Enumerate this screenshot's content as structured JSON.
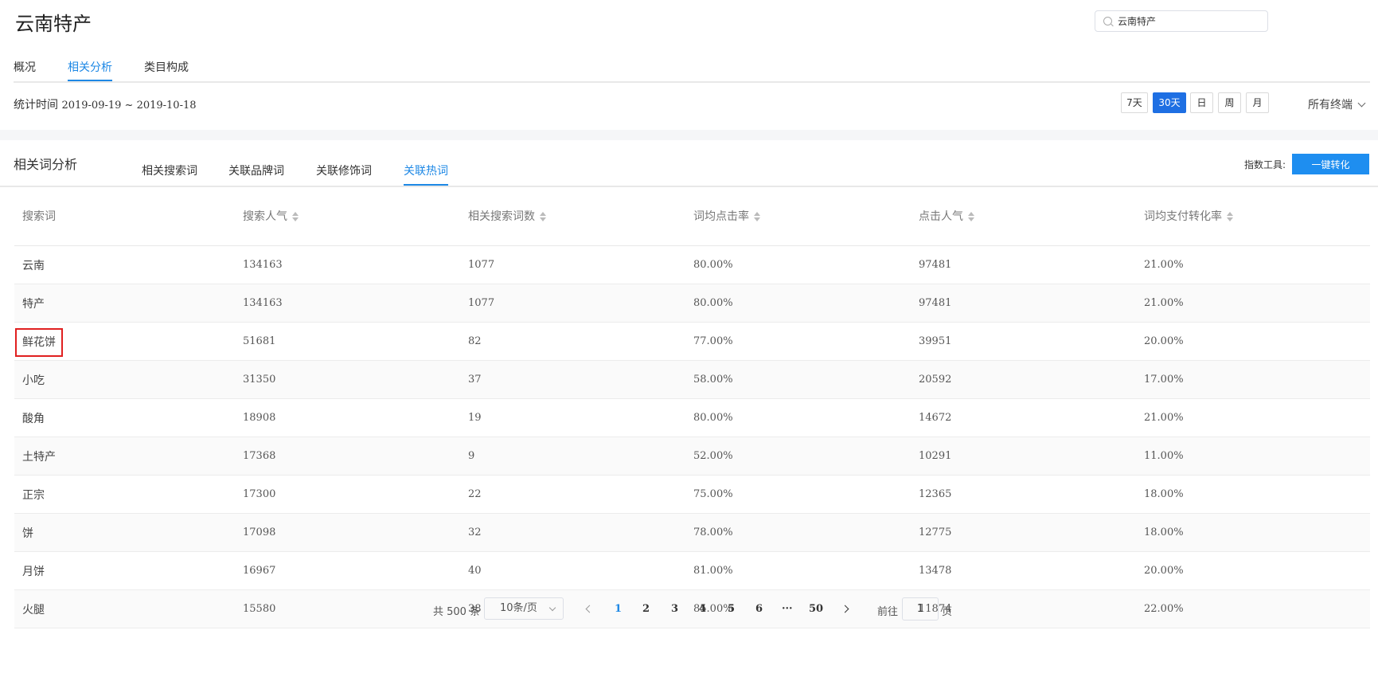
{
  "page": {
    "title": "云南特产"
  },
  "search": {
    "value": "云南特产",
    "icon": "search-icon"
  },
  "top_tabs": [
    {
      "label": "概况"
    },
    {
      "label": "相关分析",
      "active": true
    },
    {
      "label": "类目构成"
    }
  ],
  "stat": {
    "label": "统计时间",
    "range": "2019-09-19 ~ 2019-10-18"
  },
  "range_buttons": [
    {
      "label": "7天"
    },
    {
      "label": "30天",
      "active": true
    },
    {
      "label": "日"
    },
    {
      "label": "周"
    },
    {
      "label": "月"
    }
  ],
  "terminal": {
    "label": "所有终端"
  },
  "section": {
    "title": "相关词分析",
    "tabs": [
      {
        "label": "相关搜索词"
      },
      {
        "label": "关联品牌词"
      },
      {
        "label": "关联修饰词"
      },
      {
        "label": "关联热词",
        "active": true
      }
    ],
    "tool_label": "指数工具:",
    "convert_button": "一键转化"
  },
  "table": {
    "headers": [
      "搜索词",
      "搜索人气",
      "相关搜索词数",
      "词均点击率",
      "点击人气",
      "词均支付转化率"
    ],
    "rows": [
      [
        "云南",
        "134163",
        "1077",
        "80.00%",
        "97481",
        "21.00%"
      ],
      [
        "特产",
        "134163",
        "1077",
        "80.00%",
        "97481",
        "21.00%"
      ],
      [
        "鲜花饼",
        "51681",
        "82",
        "77.00%",
        "39951",
        "20.00%"
      ],
      [
        "小吃",
        "31350",
        "37",
        "58.00%",
        "20592",
        "17.00%"
      ],
      [
        "酸角",
        "18908",
        "19",
        "80.00%",
        "14672",
        "21.00%"
      ],
      [
        "土特产",
        "17368",
        "9",
        "52.00%",
        "10291",
        "11.00%"
      ],
      [
        "正宗",
        "17300",
        "22",
        "75.00%",
        "12365",
        "18.00%"
      ],
      [
        "饼",
        "17098",
        "32",
        "78.00%",
        "12775",
        "18.00%"
      ],
      [
        "月饼",
        "16967",
        "40",
        "81.00%",
        "13478",
        "20.00%"
      ],
      [
        "火腿",
        "15580",
        "38",
        "85.00%",
        "11874",
        "22.00%"
      ]
    ],
    "highlighted_keyword": "鲜花饼",
    "highlight_color": "#e02020"
  },
  "pager": {
    "total": "共 500 条",
    "page_size": "10条/页",
    "pages": [
      "1",
      "2",
      "3",
      "4",
      "5",
      "6",
      "···",
      "50"
    ],
    "current": "1",
    "goto_label": "前往",
    "goto_value": "1",
    "goto_suffix": "页"
  },
  "colors": {
    "accent": "#1e88e5",
    "primary_button": "#1e6fe3",
    "convert_button": "#1e8ef0"
  }
}
